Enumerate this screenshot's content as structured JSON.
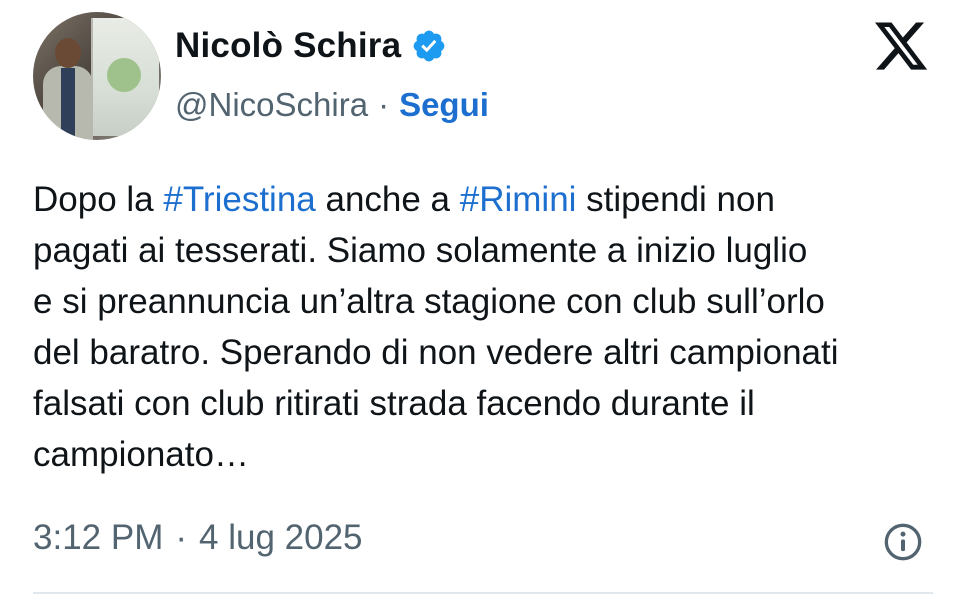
{
  "author": {
    "display_name": "Nicolò Schira",
    "handle": "@NicoSchira",
    "separator": "·",
    "follow_label": "Segui",
    "verified": true
  },
  "icons": {
    "avatar": "profile-photo",
    "verified": "verified-badge-icon",
    "platform": "x-logo-icon",
    "info": "info-icon"
  },
  "tweet": {
    "segments": [
      {
        "text": "Dopo la ",
        "type": "text"
      },
      {
        "text": "#Triestina",
        "type": "hashtag"
      },
      {
        "text": " anche a ",
        "type": "text"
      },
      {
        "text": "#Rimini",
        "type": "hashtag"
      },
      {
        "text": " stipendi non\npagati ai tesserati. Siamo solamente a inizio luglio\ne si preannuncia un’altra stagione con club sull’orlo\ndel baratro. Sperando di non vedere altri campionati\nfalsati con club ritirati strada facendo durante il\ncampionato…",
        "type": "text"
      }
    ]
  },
  "meta": {
    "time": "3:12 PM",
    "separator": "·",
    "date": "4 lug 2025"
  },
  "colors": {
    "link": "#1d6fcf",
    "secondary_text": "#536471",
    "primary_text": "#0f1419",
    "verified_badge": "#1d9bf0"
  }
}
